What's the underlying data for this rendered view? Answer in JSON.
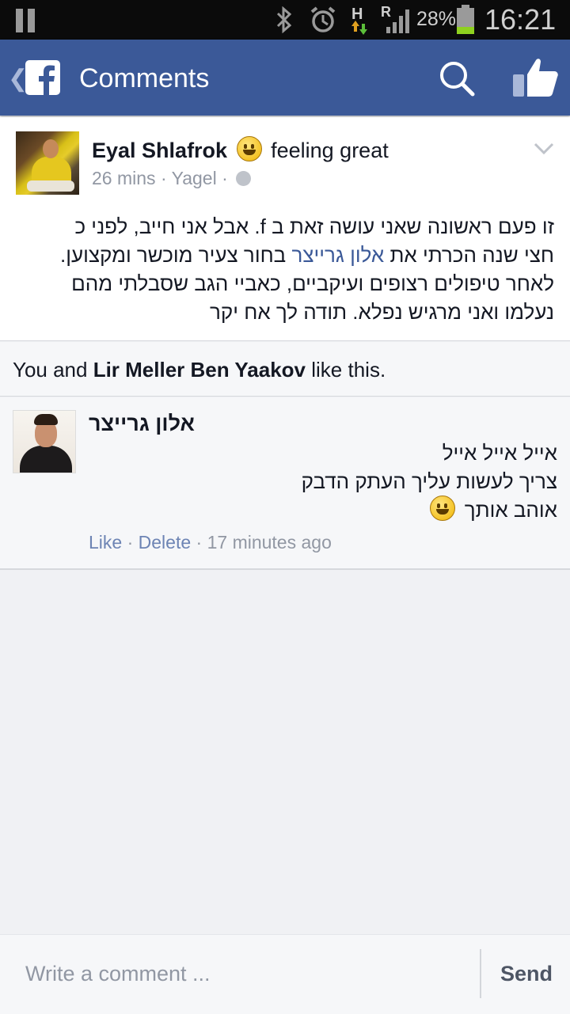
{
  "status_bar": {
    "battery_percent": "28%",
    "time": "16:21",
    "network_type": "H",
    "roaming": "R",
    "icons": [
      "pause-icon",
      "bluetooth-icon",
      "alarm-icon",
      "network-icon",
      "signal-icon",
      "battery-icon"
    ]
  },
  "header": {
    "title": "Comments",
    "icons": [
      "back-icon",
      "facebook-logo-icon",
      "search-icon",
      "like-icon"
    ],
    "brand_color": "#3b5998"
  },
  "post": {
    "author": "Eyal Shlafrok",
    "feeling": "feeling great",
    "time": "26 mins",
    "location": "Yagel",
    "sep": "·",
    "text_lines": [
      {
        "before": "זו פעם ראשונה שאני עושה זאת ב f. אבל אני חייב, לפני כ",
        "mention": "",
        "after": ""
      },
      {
        "before": "חצי שנה הכרתי את ",
        "mention": "אלון גרייצר",
        "after": " בחור צעיר מוכשר ומקצוען."
      },
      {
        "before": "לאחר טיפולים רצופים ועיקביים, כאביי הגב שסבלתי מהם",
        "mention": "",
        "after": ""
      },
      {
        "before": "נעלמו ואני מרגיש נפלא. תודה לך אח יקר",
        "mention": "",
        "after": ""
      }
    ]
  },
  "likes": {
    "prefix": "You and ",
    "name": "Lir Meller Ben Yaakov",
    "suffix": " like this."
  },
  "comment": {
    "author": "אלון גרייצר",
    "lines": [
      "אייל אייל אייל",
      "צריך לעשות עליך העתק הדבק",
      "אוהב אותך"
    ],
    "like_label": "Like",
    "delete_label": "Delete",
    "time": "17 minutes ago",
    "sep": " · "
  },
  "composer": {
    "placeholder": "Write a comment ...",
    "send_label": "Send"
  }
}
